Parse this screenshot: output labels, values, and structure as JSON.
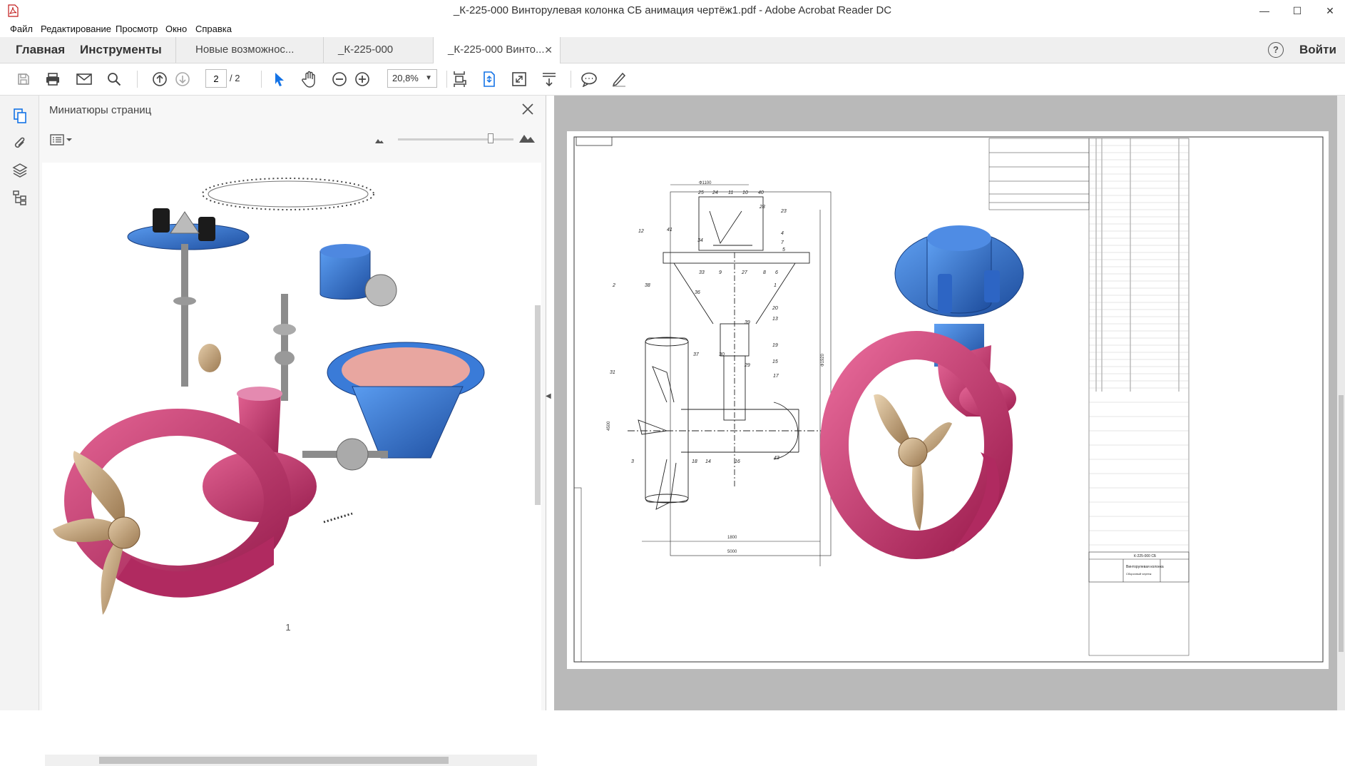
{
  "window": {
    "title": "_К-225-000 Винторулевая колонка СБ анимация чертёж1.pdf - Adobe Acrobat Reader DC",
    "minimize": "—",
    "maximize": "☐",
    "close": "✕"
  },
  "menu": [
    "Файл",
    "Редактирование",
    "Просмотр",
    "Окно",
    "Справка"
  ],
  "tabs": {
    "home": "Главная",
    "tools": "Инструменты",
    "documents": [
      {
        "label": "Новые возможнос..."
      },
      {
        "label": "_К-225-000 Винто..."
      },
      {
        "label": "_К-225-000 Винто...",
        "active": true
      }
    ],
    "close_glyph": "✕",
    "help": "?",
    "signin": "Войти"
  },
  "toolbar": {
    "current_page": "2",
    "total_pages": "/ 2",
    "zoom": "20,8%",
    "icons": [
      "save-icon",
      "print-icon",
      "email-icon",
      "search-icon",
      "page-up-icon",
      "page-down-icon",
      "select-cursor-icon",
      "hand-tool-icon",
      "zoom-out-icon",
      "zoom-in-icon",
      "fit-page-icon",
      "scrolling-mode-icon",
      "full-screen-icon",
      "read-mode-icon",
      "comment-icon",
      "sign-pen-icon"
    ]
  },
  "left_rail": {
    "icons": [
      "page-thumbnails-icon",
      "attachments-icon",
      "layers-icon",
      "tags-icon"
    ]
  },
  "thumb_panel": {
    "title": "Миниатюры страниц",
    "page_label": "1"
  },
  "drawing": {
    "stamp_code": "К-225-000 СБ",
    "stamp_name": "Винторулевая колонка",
    "stamp_sub": "Сборочный чертеж",
    "dims": [
      "Ф1100",
      "Ф1920",
      "4500",
      "1800",
      "5000"
    ],
    "balloons": [
      "25",
      "24",
      "11",
      "10",
      "40",
      "28",
      "23",
      "12",
      "41",
      "34",
      "4",
      "7",
      "5",
      "33",
      "9",
      "27",
      "8",
      "6",
      "2",
      "38",
      "36",
      "1",
      "20",
      "39",
      "13",
      "19",
      "37",
      "30",
      "29",
      "15",
      "31",
      "17",
      "43",
      "3",
      "18",
      "14",
      "16"
    ]
  },
  "colors": {
    "hull": "#c2356b",
    "housing_blue": "#2f6fd1",
    "propeller": "#c9a77e",
    "metal": "#8c8c8c",
    "accent": "#1473e6"
  }
}
